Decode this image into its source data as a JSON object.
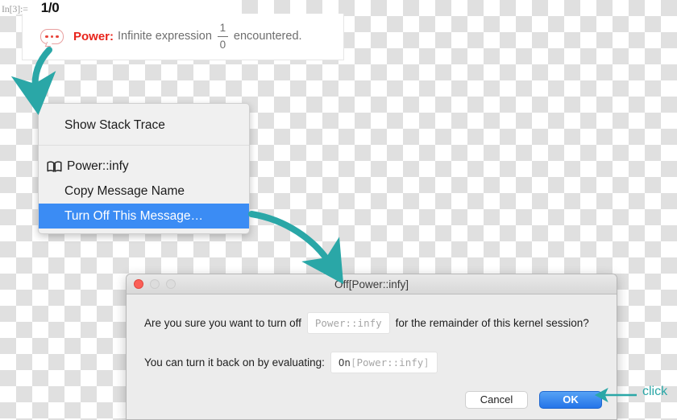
{
  "notebook": {
    "input_label": "In[3]:=",
    "input_expression": "1/0",
    "message": {
      "badge_icon": "ellipsis-speech-bubble-icon",
      "tag": "Power",
      "colon": ":",
      "text_before": "Infinite expression",
      "fraction_numerator": "1",
      "fraction_denominator": "0",
      "text_after": "encountered."
    }
  },
  "context_menu": {
    "items": [
      {
        "label": "Show Stack Trace",
        "icon": null,
        "highlighted": false
      },
      {
        "label": "Power::infy",
        "icon": "book-icon",
        "highlighted": false
      },
      {
        "label": "Copy Message Name",
        "icon": null,
        "highlighted": false
      },
      {
        "label": "Turn Off This Message…",
        "icon": null,
        "highlighted": true
      }
    ]
  },
  "dialog": {
    "title": "Off[Power::infy]",
    "traffic_lights": [
      "close-button",
      "minimize-button",
      "zoom-button"
    ],
    "line1_before": "Are you sure you want to turn off",
    "line1_code": "Power::infy",
    "line1_after": "for the remainder of this kernel session?",
    "line2_before": "You can turn it back on by evaluating:",
    "line2_code_head": "On",
    "line2_code_open": "[",
    "line2_code_body": "Power::infy",
    "line2_code_close": "]",
    "cancel_label": "Cancel",
    "ok_label": "OK"
  },
  "annotations": {
    "click_label": "click",
    "accent_color": "#2aa7a7",
    "highlight_color": "#3b8cf4",
    "error_color": "#e8241c"
  }
}
